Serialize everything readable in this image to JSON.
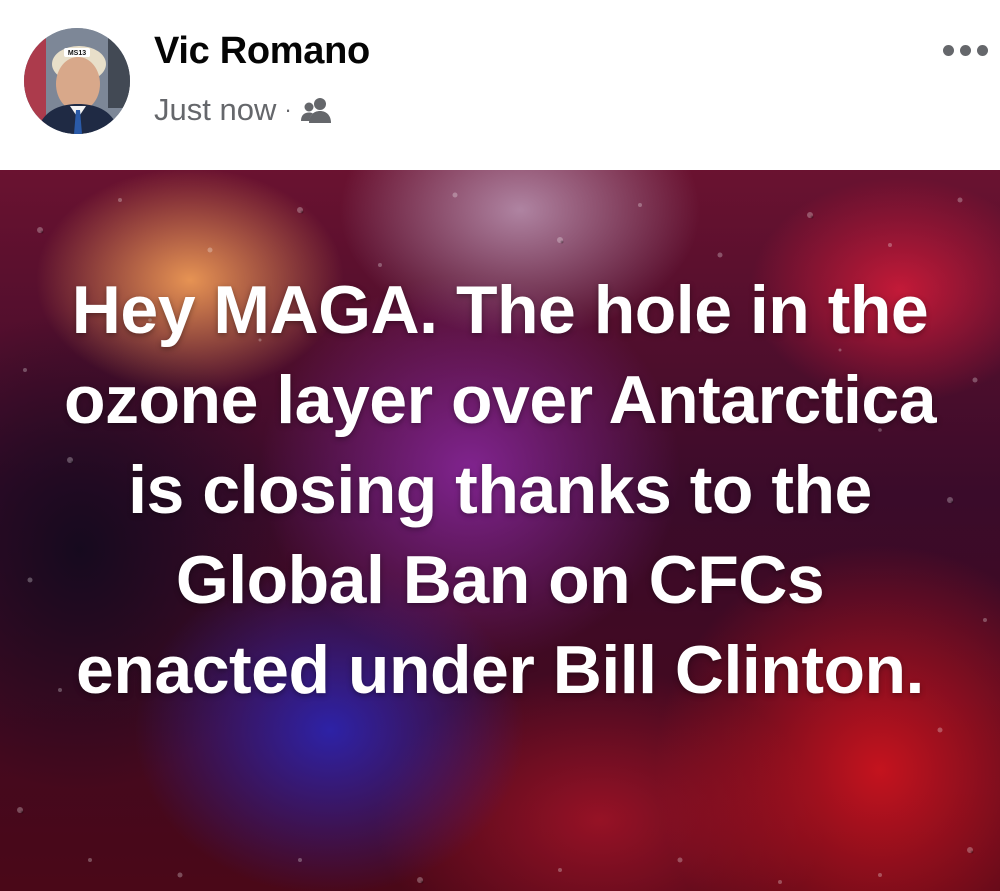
{
  "post": {
    "author": {
      "name": "Vic Romano",
      "avatar_badge": "MS13"
    },
    "timestamp": "Just now",
    "separator": "·",
    "audience_icon": "friends-icon",
    "more_icon": "more-options-icon",
    "image_text": "Hey MAGA. The hole in the ozone layer over Antarctica is closing thanks to the Global Ban on CFCs enacted under Bill Clinton."
  },
  "colors": {
    "name_text": "#050505",
    "secondary_text": "#65676b",
    "post_text": "#ffffff"
  }
}
